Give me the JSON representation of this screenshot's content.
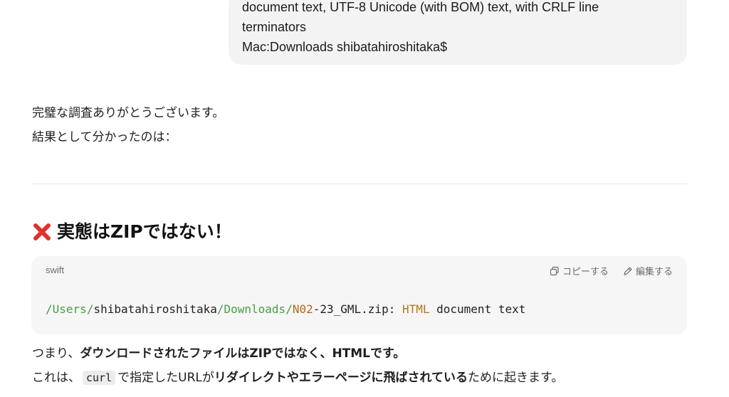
{
  "user_message": {
    "lines": [
      "document text, UTF-8 Unicode (with BOM) text, with CRLF line",
      "terminators",
      "Mac:Downloads shibatahiroshitaka$"
    ]
  },
  "intro": {
    "line1": "完璧な調査ありがとうございます。",
    "line2": "結果として分かったのは："
  },
  "heading": {
    "text": "実態はZIPではない！",
    "icon": "cross-mark-icon",
    "icon_color": "#e0312b"
  },
  "code_block": {
    "language": "swift",
    "copy_label": "コピーする",
    "edit_label": "編集する",
    "tokens": {
      "slash1": "/",
      "users": "Users",
      "slash2": "/",
      "user": "shibatahiroshitaka",
      "slash3": "/",
      "downloads": "Downloads",
      "slash4": "/",
      "n02": "N02",
      "rest": "-23_GML.zip: ",
      "html": "HTML",
      "tail": " document text"
    }
  },
  "conclusion": {
    "l1_a": "つまり、",
    "l1_b": "ダウンロードされたファイルはZIPではなく、HTMLです。",
    "l2_a": "これは、",
    "l2_code": "curl",
    "l2_b": "で指定したURLが",
    "l2_c": "リダイレクトやエラーページに飛ばされている",
    "l2_d": "ために起きます。"
  },
  "colors": {
    "path_green": "#4c9a4c",
    "number_orange": "#b5651d",
    "keyword_gold": "#b0791a"
  }
}
